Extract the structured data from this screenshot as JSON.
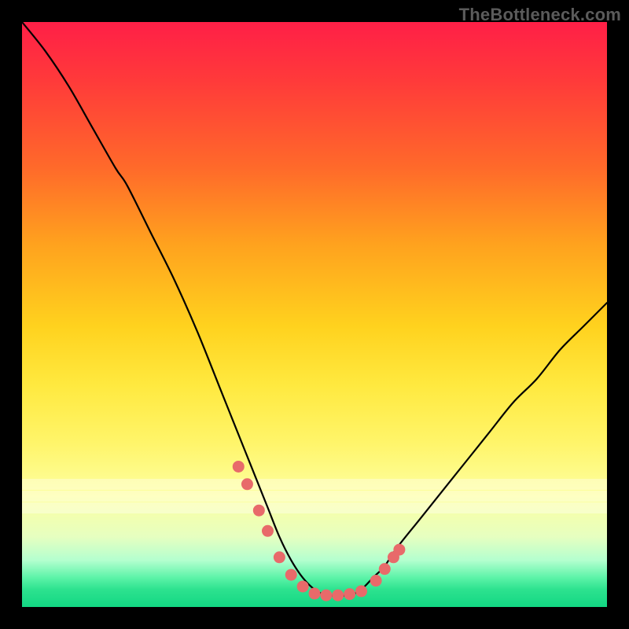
{
  "watermark": "TheBottleneck.com",
  "chart_data": {
    "type": "line",
    "title": "",
    "xlabel": "",
    "ylabel": "",
    "xlim": [
      0,
      100
    ],
    "ylim": [
      0,
      100
    ],
    "series": [
      {
        "name": "curve",
        "x": [
          0,
          4,
          8,
          12,
          16,
          18,
          22,
          26,
          30,
          34,
          36,
          38,
          40,
          42,
          44,
          46,
          48,
          50,
          52,
          54,
          56,
          58,
          60,
          62,
          64,
          68,
          72,
          76,
          80,
          84,
          88,
          92,
          96,
          100
        ],
        "y": [
          100,
          95,
          89,
          82,
          75,
          72,
          64,
          56,
          47,
          37,
          32,
          27,
          22,
          17,
          12,
          8,
          5,
          3,
          2,
          2,
          2,
          3,
          5,
          7,
          10,
          15,
          20,
          25,
          30,
          35,
          39,
          44,
          48,
          52
        ]
      }
    ],
    "markers": {
      "name": "highlighted-points",
      "x": [
        37,
        38.5,
        40.5,
        42,
        44,
        46,
        48,
        50,
        52,
        54,
        56,
        58,
        60.5,
        62,
        63.5,
        64.5
      ],
      "y": [
        24,
        21,
        16.5,
        13,
        8.5,
        5.5,
        3.5,
        2.3,
        2,
        2,
        2.2,
        2.7,
        4.5,
        6.5,
        8.5,
        9.8
      ]
    },
    "bands_y": [
      21,
      19,
      17
    ],
    "colors": {
      "curve": "#000000",
      "marker": "#e86a6a",
      "gradient_top": "#ff1f47",
      "gradient_bottom": "#12d783"
    }
  }
}
